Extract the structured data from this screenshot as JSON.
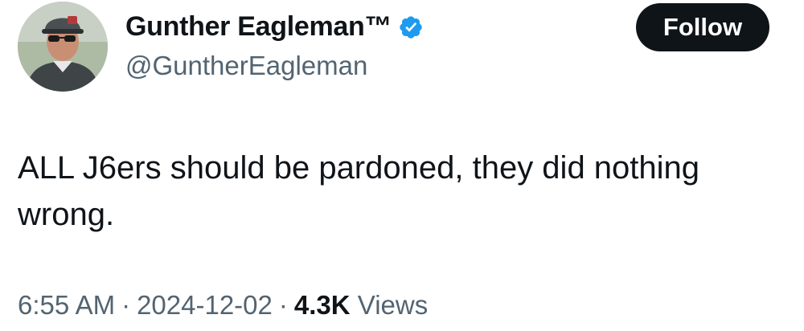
{
  "author": {
    "display_name": "Gunther Eagleman™",
    "handle": "@GuntherEagleman",
    "verified_icon": "verified-badge-icon",
    "badge_color": "#1d9bf0"
  },
  "actions": {
    "follow_label": "Follow"
  },
  "tweet": {
    "text": "ALL J6ers should be pardoned,  they did nothing wrong."
  },
  "meta": {
    "time": "6:55 AM",
    "separator": "·",
    "date": "2024-12-02",
    "views_count": "4.3K",
    "views_label": "Views"
  }
}
